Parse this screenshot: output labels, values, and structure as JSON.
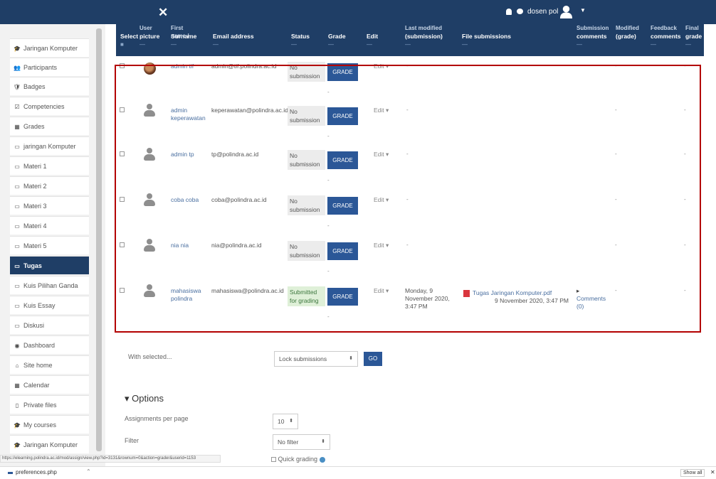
{
  "topbar": {
    "close_glyph": "✕",
    "user_name": "dosen pol",
    "icons": [
      "bell-icon",
      "chat-icon",
      "avatar-icon"
    ]
  },
  "drawer": {
    "items": [
      {
        "label": "Jaringan Komputer",
        "icon": "🎓"
      },
      {
        "label": "Participants",
        "icon": "👥"
      },
      {
        "label": "Badges",
        "icon": "🛡"
      },
      {
        "label": "Competencies",
        "icon": "☑"
      },
      {
        "label": "Grades",
        "icon": "▦"
      },
      {
        "label": "jaringan Komputer",
        "icon": "▭"
      },
      {
        "label": "Materi 1",
        "icon": "▭"
      },
      {
        "label": "Materi 2",
        "icon": "▭"
      },
      {
        "label": "Materi 3",
        "icon": "▭"
      },
      {
        "label": "Materi 4",
        "icon": "▭"
      },
      {
        "label": "Materi 5",
        "icon": "▭"
      },
      {
        "label": "Tugas",
        "icon": "▭"
      },
      {
        "label": "Kuis Pilihan Ganda",
        "icon": "▭"
      },
      {
        "label": "Kuis Essay",
        "icon": "▭"
      },
      {
        "label": "Diskusi",
        "icon": "▭"
      },
      {
        "label": "Dashboard",
        "icon": "◉"
      },
      {
        "label": "Site home",
        "icon": "⌂"
      },
      {
        "label": "Calendar",
        "icon": "▦"
      },
      {
        "label": "Private files",
        "icon": "▯"
      },
      {
        "label": "My courses",
        "icon": "🎓"
      },
      {
        "label": "Jaringan Komputer",
        "icon": "🎓"
      }
    ]
  },
  "table": {
    "headers": {
      "select": "Select",
      "user": "User",
      "picture": "picture",
      "first_name": "First name /",
      "surname": "Surname",
      "email": "Email address",
      "status": "Status",
      "grade": "Grade",
      "edit": "Edit",
      "last": "Last modified",
      "submission": "(submission)",
      "files": "File submissions",
      "subm_comments_1": "Submission",
      "subm_comments_2": "comments",
      "modified_1": "Modified",
      "modified_2": "(grade)",
      "feedback_1": "Feedback",
      "feedback_2": "comments",
      "final_1": "Final",
      "final_2": "grade",
      "dash": "—"
    },
    "grade_label": "GRADE",
    "edit_label": "Edit ▾",
    "dash": "-",
    "rows": [
      {
        "name": "admin tif",
        "email": "admin@tif.polindra.ac.id",
        "status_1": "No",
        "status_2": "submission"
      },
      {
        "name": "admin keperawatan",
        "email": "keperawatan@polindra.ac.id",
        "status_1": "No",
        "status_2": "submission"
      },
      {
        "name": "admin tp",
        "email": "tp@polindra.ac.id",
        "status_1": "No",
        "status_2": "submission"
      },
      {
        "name": "coba coba",
        "email": "coba@polindra.ac.id",
        "status_1": "No",
        "status_2": "submission"
      },
      {
        "name": "nia nia",
        "email": "nia@polindra.ac.id",
        "status_1": "No",
        "status_2": "submission"
      },
      {
        "name": "mahasiswa polindra",
        "email": "mahasiswa@polindra.ac.id",
        "status_1": "Submitted",
        "status_2": "for grading",
        "modified": "Monday, 9 November 2020, 3:47 PM",
        "file_name": "Tugas Jaringan Komputer.pdf",
        "file_date": "9 November 2020, 3:47 PM",
        "comments_toggle": "▸",
        "comments": "Comments (0)"
      }
    ]
  },
  "bulk": {
    "label": "With selected...",
    "action": "Lock submissions",
    "go": "GO"
  },
  "options": {
    "title": "▾ Options",
    "per_page_label": "Assignments per page",
    "per_page_value": "10",
    "filter_label": "Filter",
    "filter_value": "No filter",
    "quick_grading": "Quick grading"
  },
  "statusbar": {
    "url": "https://elearning.polindra.ac.id/mod/assign/view.php?id=3131&rownum=0&action=grader&userid=1153"
  },
  "downloads": {
    "file": "preferences.php",
    "show_all": "Show all",
    "close": "✕"
  }
}
